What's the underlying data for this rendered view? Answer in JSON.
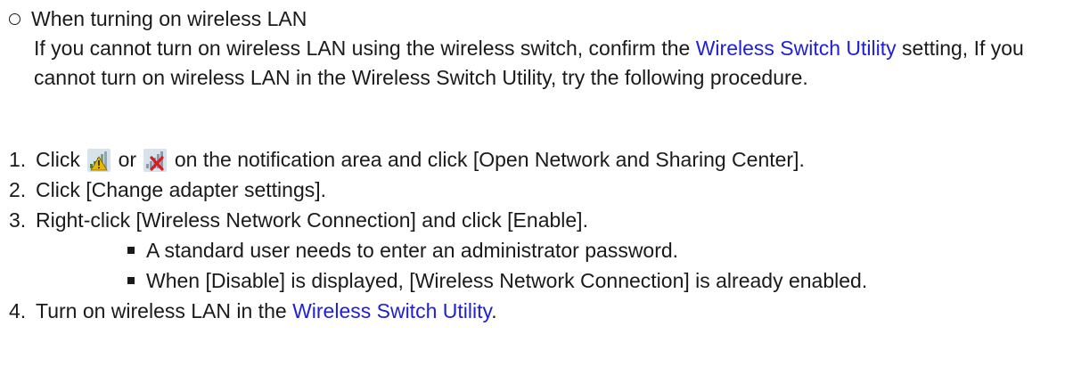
{
  "section": {
    "title": "When turning on wireless LAN",
    "para_1": "If you cannot turn on wireless LAN using the wireless switch, confirm the ",
    "para_link": "Wireless Switch Utility",
    "para_2": " setting, If you cannot turn on wireless LAN in the Wireless Switch Utility, try the following procedure."
  },
  "steps": [
    {
      "number": "1.",
      "text_1": "Click ",
      "icon_a": "wireless-signal-warning-icon",
      "text_or": " or ",
      "icon_b": "wireless-disconnected-icon",
      "text_2": " on the notification area and click [Open Network and Sharing Center]."
    },
    {
      "number": "2.",
      "text": "Click [Change adapter settings]."
    },
    {
      "number": "3.",
      "text": "Right-click [Wireless Network Connection] and click [Enable].",
      "bullets": [
        "A standard user needs to enter an administrator password.",
        "When [Disable] is displayed, [Wireless Network Connection] is already enabled."
      ]
    },
    {
      "number": "4.",
      "text_1": "Turn on wireless LAN in the ",
      "link": "Wireless Switch Utility",
      "text_2": "."
    }
  ],
  "colors": {
    "text": "#1a1a1a",
    "link": "#1f1fd6",
    "warning": "#e8b800",
    "error": "#d81e1e"
  }
}
